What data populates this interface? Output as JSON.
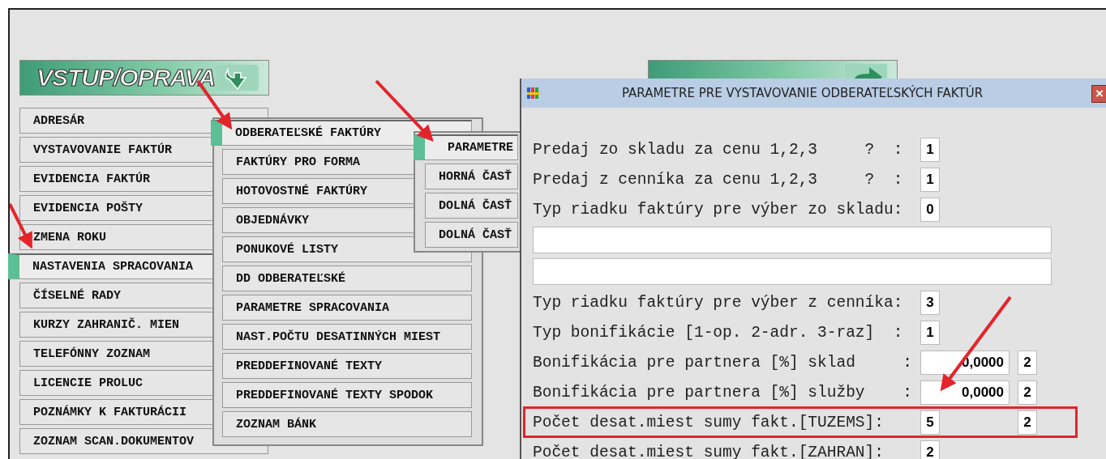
{
  "banners": [
    {
      "title": "VSTUP/OPRAVA",
      "kind": "down"
    },
    {
      "kind": "right"
    }
  ],
  "main_menu": [
    {
      "label": "ADRESÁR",
      "selected": false
    },
    {
      "label": "VYSTAVOVANIE FAKTÚR",
      "selected": false
    },
    {
      "label": "EVIDENCIA FAKTÚR",
      "selected": false
    },
    {
      "label": "EVIDENCIA POŠTY",
      "selected": false
    },
    {
      "label": "ZMENA ROKU",
      "selected": false
    },
    {
      "label": "NASTAVENIA SPRACOVANIA",
      "selected": true
    },
    {
      "label": "ČÍSELNÉ RADY",
      "selected": false
    },
    {
      "label": "KURZY ZAHRANIČ. MIEN",
      "selected": false
    },
    {
      "label": "TELEFÓNNY ZOZNAM",
      "selected": false
    },
    {
      "label": "LICENCIE PROLUC",
      "selected": false
    },
    {
      "label": "POZNÁMKY K FAKTURÁCII",
      "selected": false
    },
    {
      "label": "ZOZNAM SCAN.DOKUMENTOV",
      "selected": false
    }
  ],
  "submenu": [
    {
      "label": "ODBERATEĽSKÉ FAKTÚRY",
      "selected": true
    },
    {
      "label": "FAKTÚRY PRO FORMA",
      "selected": false
    },
    {
      "label": "HOTOVOSTNÉ FAKTÚRY",
      "selected": false
    },
    {
      "label": "OBJEDNÁVKY",
      "selected": false
    },
    {
      "label": "PONUKOVÉ LISTY",
      "selected": false
    },
    {
      "label": "DD ODBERATEĽSKÉ",
      "selected": false
    },
    {
      "label": "PARAMETRE SPRACOVANIA",
      "selected": false
    },
    {
      "label": "NAST.POČTU DESATINNÝCH MIEST",
      "selected": false
    },
    {
      "label": "PREDDEFINOVANÉ TEXTY",
      "selected": false
    },
    {
      "label": "PREDDEFINOVANÉ TEXTY SPODOK",
      "selected": false
    },
    {
      "label": "ZOZNAM BÁNK",
      "selected": false
    }
  ],
  "submenu_2": [
    {
      "label": "PARAMETRE",
      "selected": true
    },
    {
      "label": "HORNÁ ČASŤ",
      "selected": false
    },
    {
      "label": "DOLNÁ ČASŤ",
      "selected": false
    },
    {
      "label": "DOLNÁ ČASŤ",
      "selected": false
    }
  ],
  "dialog": {
    "title": "PARAMETRE PRE VYSTAVOVANIE ODBERATEĽSKÝCH FAKTÚR",
    "close": "×",
    "rows": [
      {
        "kind": "field",
        "label": "Predaj zo skladu za cenu 1,2,3     ?  :",
        "value": "1",
        "highlighted": false
      },
      {
        "kind": "field",
        "label": "Predaj z cenníka za cenu 1,2,3     ?  :",
        "value": "1",
        "highlighted": false
      },
      {
        "kind": "field",
        "label": "Typ riadku faktúry pre výber zo skladu:",
        "value": "0",
        "highlighted": false
      },
      {
        "kind": "wide"
      },
      {
        "kind": "wide"
      },
      {
        "kind": "field",
        "label": "Typ riadku faktúry pre výber z cenníka:",
        "value": "3",
        "highlighted": false
      },
      {
        "kind": "field",
        "label": "Typ bonifikácie [1-op. 2-adr. 3-raz]  :",
        "value": "1",
        "highlighted": false
      },
      {
        "kind": "number",
        "label": "Bonifikácia pre partnera [%] sklad     :",
        "value": "0,0000",
        "value2": "2",
        "highlighted": false
      },
      {
        "kind": "number",
        "label": "Bonifikácia pre partnera [%] služby    :",
        "value": "0,0000",
        "value2": "2",
        "highlighted": false
      },
      {
        "kind": "field",
        "label": "Počet desat.miest sumy fakt.[TUZEMS]:",
        "value": "5",
        "value2": "2",
        "highlighted": true
      },
      {
        "kind": "field",
        "label": "Počet desat.miest sumy fakt.[ZAHRAN]:",
        "value": "2",
        "highlighted": false
      }
    ]
  }
}
